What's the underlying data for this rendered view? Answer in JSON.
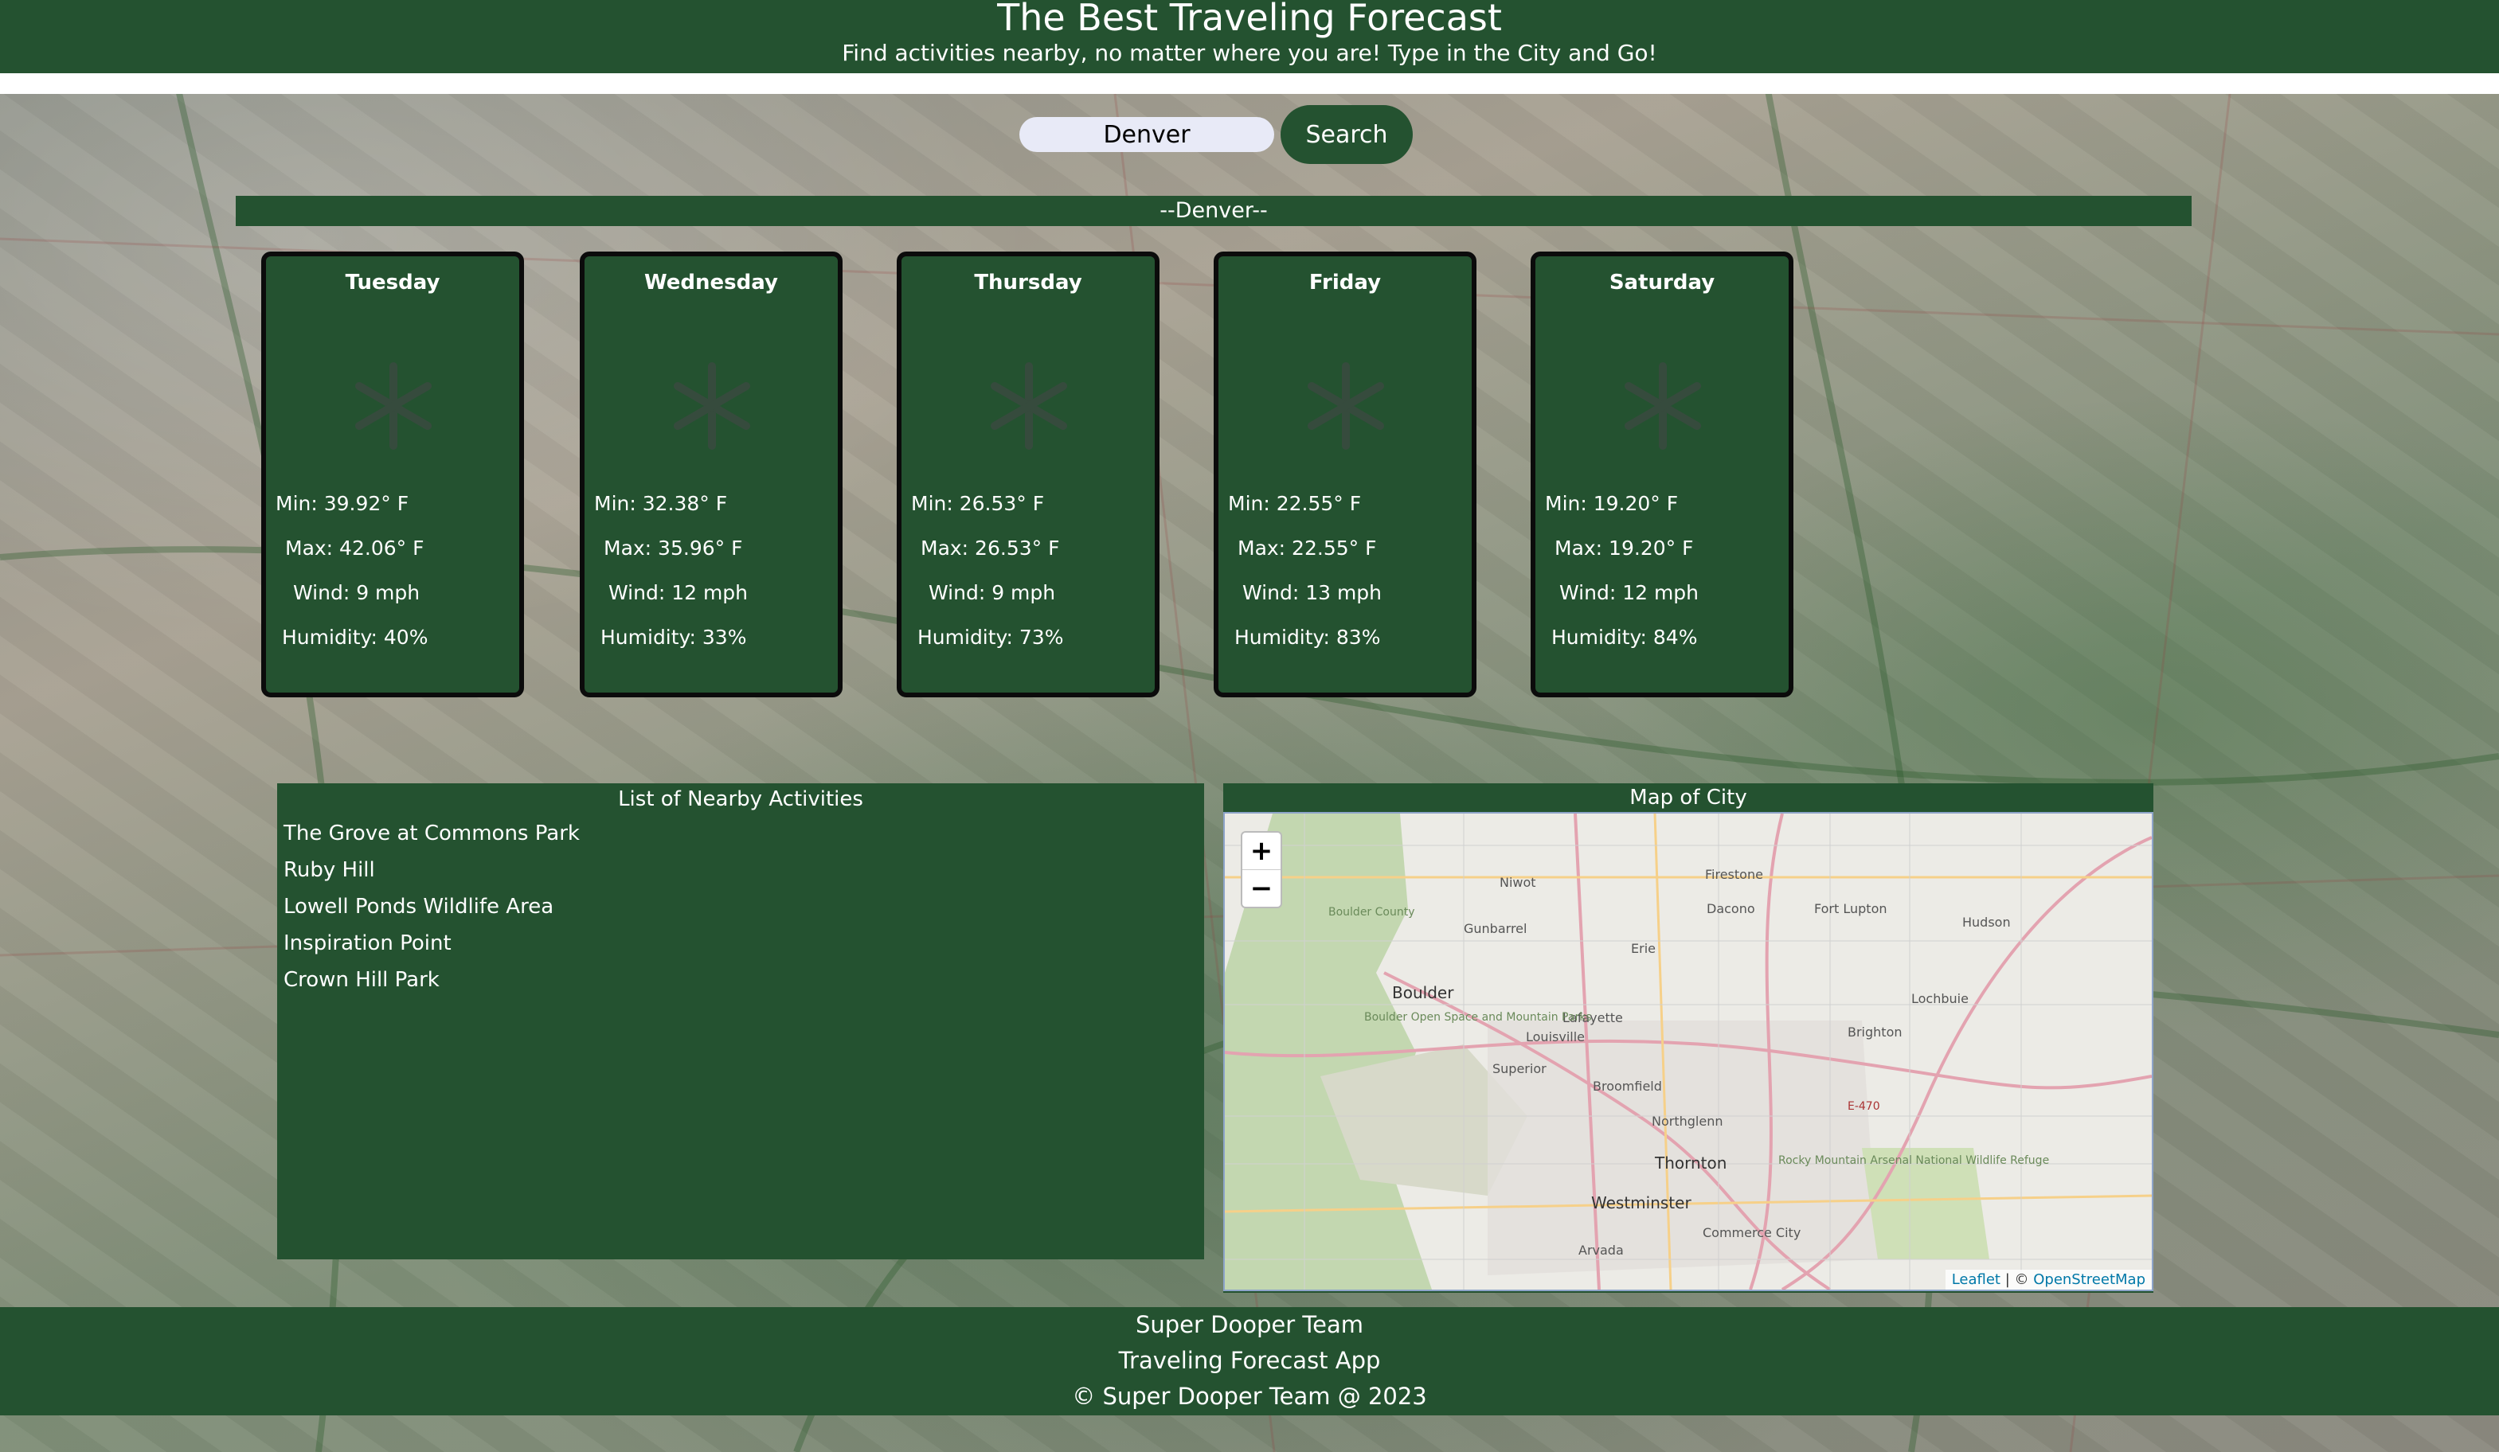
{
  "header": {
    "title": "The Best Traveling Forecast",
    "subtitle": "Find activities nearby, no matter where you are! Type in the City and Go!"
  },
  "search": {
    "value": "Denver",
    "button_label": "Search"
  },
  "city_heading": "--Denver--",
  "forecast": [
    {
      "day": "Tuesday",
      "icon": "snowflake-icon",
      "min": "Min: 39.92° F",
      "max": "Max: 42.06° F",
      "wind": "Wind: 9 mph",
      "humidity": "Humidity: 40%"
    },
    {
      "day": "Wednesday",
      "icon": "snowflake-icon",
      "min": "Min: 32.38° F",
      "max": "Max: 35.96° F",
      "wind": "Wind: 12 mph",
      "humidity": "Humidity: 33%"
    },
    {
      "day": "Thursday",
      "icon": "snowflake-icon",
      "min": "Min: 26.53° F",
      "max": "Max: 26.53° F",
      "wind": "Wind: 9 mph",
      "humidity": "Humidity: 73%"
    },
    {
      "day": "Friday",
      "icon": "snowflake-icon",
      "min": "Min: 22.55° F",
      "max": "Max: 22.55° F",
      "wind": "Wind: 13 mph",
      "humidity": "Humidity: 83%"
    },
    {
      "day": "Saturday",
      "icon": "snowflake-icon",
      "min": "Min: 19.20° F",
      "max": "Max: 19.20° F",
      "wind": "Wind: 12 mph",
      "humidity": "Humidity: 84%"
    }
  ],
  "activities": {
    "title": "List of Nearby Activities",
    "items": [
      "The Grove at Commons Park",
      "Ruby Hill",
      "Lowell Ponds Wildlife Area",
      "Inspiration Point",
      "Crown Hill Park"
    ]
  },
  "map": {
    "title": "Map of City",
    "zoom_in": "+",
    "zoom_out": "−",
    "attribution_leaflet": "Leaflet",
    "attribution_sep": " | © ",
    "attribution_osm": "OpenStreetMap",
    "places": [
      "Niwot",
      "Firestone",
      "Dacono",
      "Fort Lupton",
      "Hudson",
      "Gunbarrel",
      "Erie",
      "Boulder",
      "Lafayette",
      "Louisville",
      "Lochbuie",
      "Brighton",
      "Superior",
      "Broomfield",
      "Northglenn",
      "Thornton",
      "Westminster",
      "Commerce City",
      "Arvada",
      "Boulder County",
      "Boulder Open Space and Mountain Parks",
      "Rocky Mountain Arsenal National Wildlife Refuge",
      "E-470"
    ]
  },
  "footer": {
    "line1": "Super Dooper Team",
    "line2": "Traveling Forecast App",
    "line3": "© Super Dooper Team @ 2023"
  },
  "colors": {
    "primary_green": "#245230",
    "card_border": "#0b0b0b",
    "input_bg": "#e8eaf7"
  }
}
